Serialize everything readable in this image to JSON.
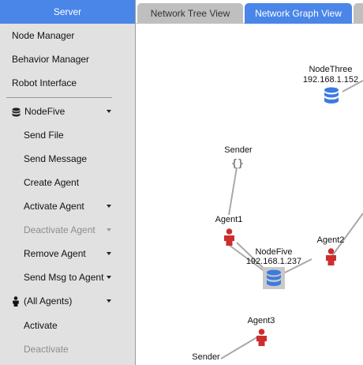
{
  "sidebar": {
    "title": "Server",
    "top_items": [
      {
        "label": "Node Manager"
      },
      {
        "label": "Behavior Manager"
      },
      {
        "label": "Robot Interface"
      }
    ],
    "node_group": {
      "label": "NodeFive",
      "icon": "database-icon"
    },
    "node_items": [
      {
        "label": "Send File"
      },
      {
        "label": "Send Message"
      },
      {
        "label": "Create Agent"
      },
      {
        "label": "Activate Agent"
      },
      {
        "label": "Deactivate Agent"
      },
      {
        "label": "Remove Agent"
      },
      {
        "label": "Send Msg to Agent"
      }
    ],
    "agents_group": {
      "label": "(All Agents)",
      "icon": "person-icon"
    },
    "agent_items": [
      {
        "label": "Activate"
      },
      {
        "label": "Deactivate"
      }
    ]
  },
  "tabs": [
    {
      "label": "Network Tree View",
      "active": false
    },
    {
      "label": "Network Graph View",
      "active": true
    }
  ],
  "graph": {
    "nodes": {
      "node_three": {
        "name": "NodeThree",
        "ip": "192.168.1.152"
      },
      "node_five": {
        "name": "NodeFive",
        "ip": "192.168.1.237"
      },
      "sender_top": {
        "name": "Sender"
      },
      "sender_bottom": {
        "name": "Sender"
      },
      "agent1": {
        "name": "Agent1"
      },
      "agent2": {
        "name": "Agent2"
      },
      "agent3": {
        "name": "Agent3"
      }
    }
  },
  "colors": {
    "accent": "#4a86e8",
    "agent": "#cc2e2e",
    "database": "#3b7be0",
    "sidebar_bg": "#e1e1e1"
  }
}
